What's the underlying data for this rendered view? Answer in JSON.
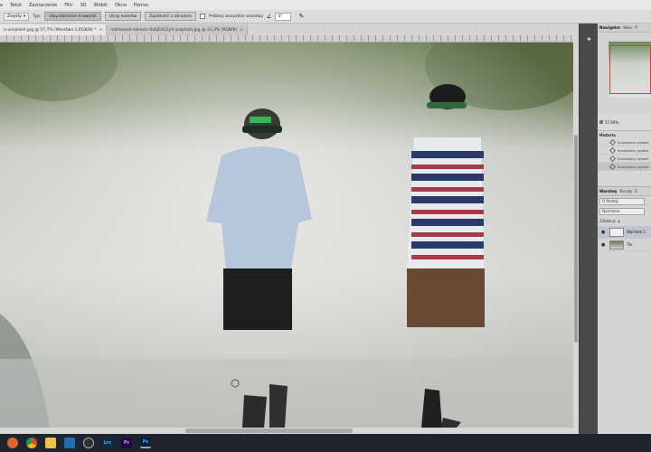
{
  "menu": [
    "a",
    "Tekst",
    "Zaznaczenie",
    "Filtr",
    "3D",
    "Widok",
    "Okno",
    "Pomoc"
  ],
  "options": {
    "brush_select": "Zwykły",
    "type_label": "Typ:",
    "btn_1": "Uwydatnienie krawędzi",
    "btn_2": "Ukryj kolorów",
    "btn_3": "Zgodność z obrazem",
    "sample_label": "Próbkuj wszystkie warstwy",
    "angle_value": "0°"
  },
  "tabs": [
    {
      "label": "o-unsplash.jpg @ 57,7% (Warstwa 1,RGB/8) *"
    },
    {
      "label": "mohamed-nohassi-0vbjEsG1yY-unsplash.jpg @ 33,3% (RGB/8)"
    }
  ],
  "panels": {
    "top_tabs": [
      "Nawigator",
      "Kolor",
      "P"
    ],
    "zoom": "57,69%",
    "history_title": "Historia",
    "history_items": [
      "Kursówany pędzel",
      "Kursówany pędzel",
      "Kursówany pędzel",
      "Kursówany pędzel"
    ],
    "layers_tabs": [
      "Warstwy",
      "Kanały",
      "Ś"
    ],
    "filter": "Q Rodzaj",
    "blend_mode": "Normalne",
    "lock_label": "Zablokuj:",
    "layers": [
      {
        "name": "Warstwa 1"
      },
      {
        "name": "Tło"
      }
    ]
  },
  "taskbar": [
    "firefox-icon",
    "chrome-icon",
    "explorer-icon",
    "photos-icon",
    "obs-icon",
    "lightroom-icon",
    "premiere-icon",
    "photoshop-icon"
  ],
  "taskbar_labels": {
    "lightroom": "Lrc",
    "premiere": "Pr",
    "photoshop": "Ps"
  }
}
